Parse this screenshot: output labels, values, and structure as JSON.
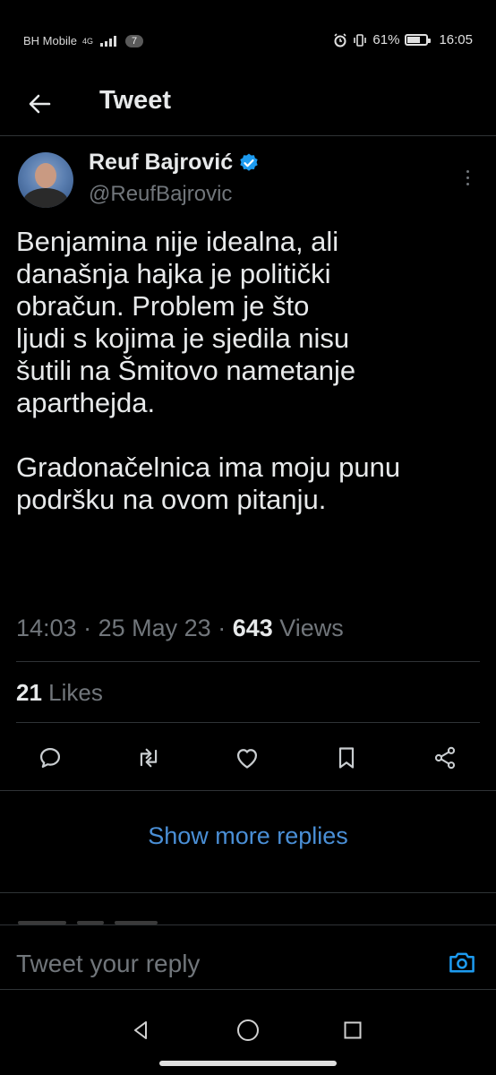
{
  "status_bar": {
    "carrier": "BH Mobile",
    "network": "4G",
    "notification_count": "7",
    "battery": "61%",
    "time": "16:05"
  },
  "header": {
    "title": "Tweet"
  },
  "tweet": {
    "author_name": "Reuf Bajrović",
    "author_handle": "@ReufBajrovic",
    "paragraphs": [
      [
        "Benjamina nije idealna, ali",
        "današnja hajka je politički",
        "obračun. Problem je što",
        "ljudi s kojima je sjedila nisu",
        "šutili na Šmitovo nametanje",
        "aparthejda."
      ],
      [
        "Gradonačelnica ima moju punu",
        "podršku na ovom pitanju."
      ]
    ],
    "time": "14:03",
    "date": "25 May 23",
    "views_count": "643",
    "views_label": "Views",
    "likes_count": "21",
    "likes_label": "Likes"
  },
  "actions": {
    "icons": [
      "reply-icon",
      "retweet-icon",
      "like-icon",
      "bookmark-icon",
      "share-icon"
    ]
  },
  "replies": {
    "show_more_label": "Show more replies"
  },
  "reply_bar": {
    "placeholder": "Tweet your reply"
  },
  "colors": {
    "background": "#000000",
    "text": "#e7e9ea",
    "muted": "#71767b",
    "link": "#4a8fd6",
    "verified": "#1d9bf0",
    "divider": "#2f3336"
  }
}
